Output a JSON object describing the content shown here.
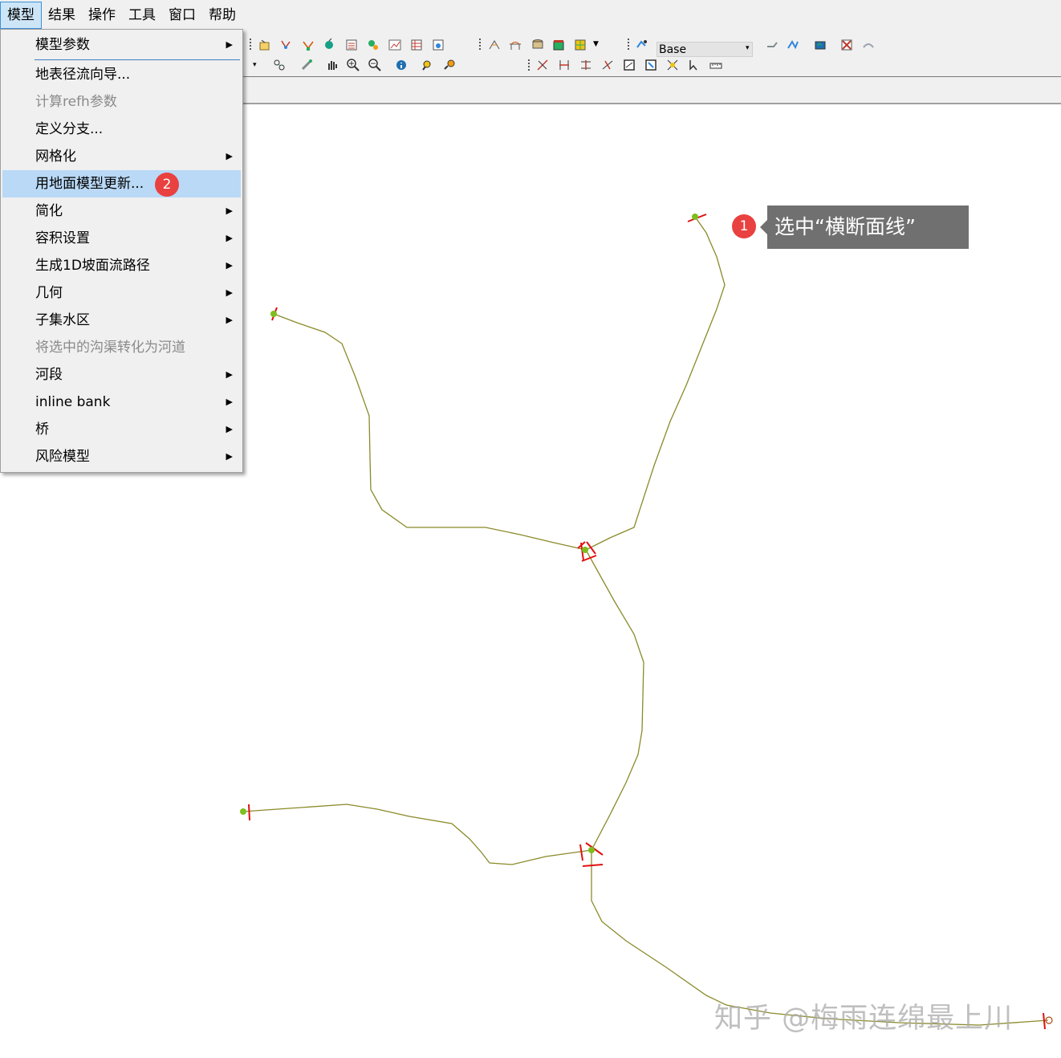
{
  "menubar": {
    "items": [
      "模型",
      "结果",
      "操作",
      "工具",
      "窗口",
      "帮助"
    ]
  },
  "toolbar": {
    "scenario_combo": "Base"
  },
  "model_menu": {
    "items": [
      {
        "label": "模型参数",
        "submenu": true,
        "disabled": false
      },
      {
        "label": "地表径流向导...",
        "submenu": false,
        "disabled": false
      },
      {
        "label": "计算refh参数",
        "submenu": false,
        "disabled": true
      },
      {
        "label": "定义分支...",
        "submenu": false,
        "disabled": false
      },
      {
        "label": "网格化",
        "submenu": true,
        "disabled": false
      },
      {
        "label": "用地面模型更新...",
        "submenu": false,
        "disabled": false,
        "highlighted": true
      },
      {
        "label": "简化",
        "submenu": true,
        "disabled": false
      },
      {
        "label": "容积设置",
        "submenu": true,
        "disabled": false
      },
      {
        "label": "生成1D坡面流路径",
        "submenu": true,
        "disabled": false
      },
      {
        "label": "几何",
        "submenu": true,
        "disabled": false
      },
      {
        "label": "子集水区",
        "submenu": true,
        "disabled": false
      },
      {
        "label": "将选中的沟渠转化为河道",
        "submenu": false,
        "disabled": true
      },
      {
        "label": "河段",
        "submenu": true,
        "disabled": false
      },
      {
        "label": "inline bank",
        "submenu": true,
        "disabled": false
      },
      {
        "label": "桥",
        "submenu": true,
        "disabled": false
      },
      {
        "label": "风险模型",
        "submenu": true,
        "disabled": false
      }
    ]
  },
  "annotations": {
    "step1_badge": "1",
    "step1_text": "选中“横断面线”",
    "step2_badge": "2"
  },
  "watermark": "知乎 @梅雨连绵最上川",
  "colors": {
    "river_line": "#8a8a2a",
    "node_fill": "#7cbf1e",
    "section_line": "#e01010",
    "menu_highlight": "#b9d9f6",
    "badge": "#e94040",
    "tooltip": "#707070"
  }
}
